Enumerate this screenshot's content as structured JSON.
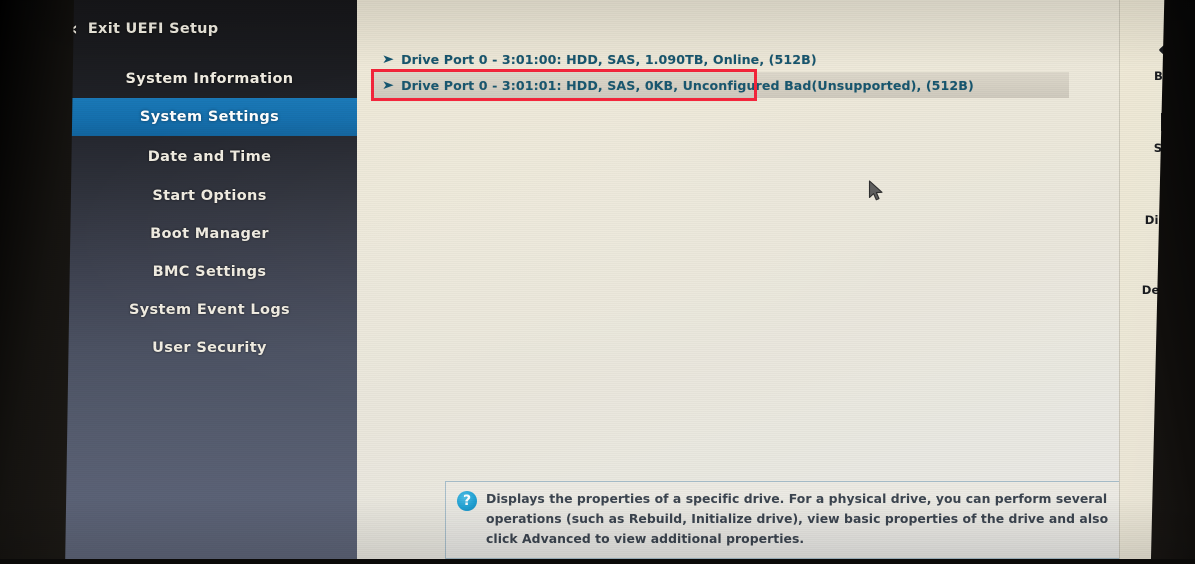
{
  "sidebar": {
    "exit": {
      "label": "Exit UEFI Setup",
      "icon": "chevron-left-icon",
      "glyph": "‹"
    },
    "items": [
      {
        "label": "System Information",
        "active": false
      },
      {
        "label": "System Settings",
        "active": true
      },
      {
        "label": "Date and Time",
        "active": false
      },
      {
        "label": "Start Options",
        "active": false
      },
      {
        "label": "Boot Manager",
        "active": false
      },
      {
        "label": "BMC Settings",
        "active": false
      },
      {
        "label": "System Event Logs",
        "active": false
      },
      {
        "label": "User Security",
        "active": false
      }
    ]
  },
  "main": {
    "drives": [
      {
        "bullet": "➤",
        "text": "Drive Port 0 - 3:01:00: HDD, SAS, 1.090TB, Online, (512B)",
        "selected": false
      },
      {
        "bullet": "➤",
        "text": "Drive Port 0 - 3:01:01: HDD, SAS, 0KB, Unconfigured Bad(Unsupported), (512B)",
        "selected": true
      }
    ],
    "help": {
      "icon": "question-mark-icon",
      "glyph": "?",
      "text": "Displays the properties of a specific drive. For a physical drive, you can perform several operations (such as Rebuild, Initialize drive), view basic properties of the drive and also click Advanced to view additional properties."
    }
  },
  "toolbar": {
    "buttons": [
      {
        "label": "Back",
        "icon": "arrow-left-icon"
      },
      {
        "label": "Save",
        "icon": "floppy-disk-icon"
      },
      {
        "label": "Discard",
        "icon": "undo-clock-icon"
      },
      {
        "label": "Defaults",
        "icon": "warning-exclamation-icon"
      }
    ]
  },
  "cursor": {
    "icon": "mouse-pointer-icon"
  },
  "annotation": {
    "shape": "rectangle",
    "color": "#f4243a"
  },
  "colors": {
    "accent_blue": "#1570ae",
    "drive_text": "#17566f",
    "panel_bg": "#eae7dc",
    "sidebar_top": "#17171a",
    "sidebar_bottom": "#5e6578",
    "annotation_red": "#f4243a",
    "help_icon_blue": "#22a3d6"
  }
}
